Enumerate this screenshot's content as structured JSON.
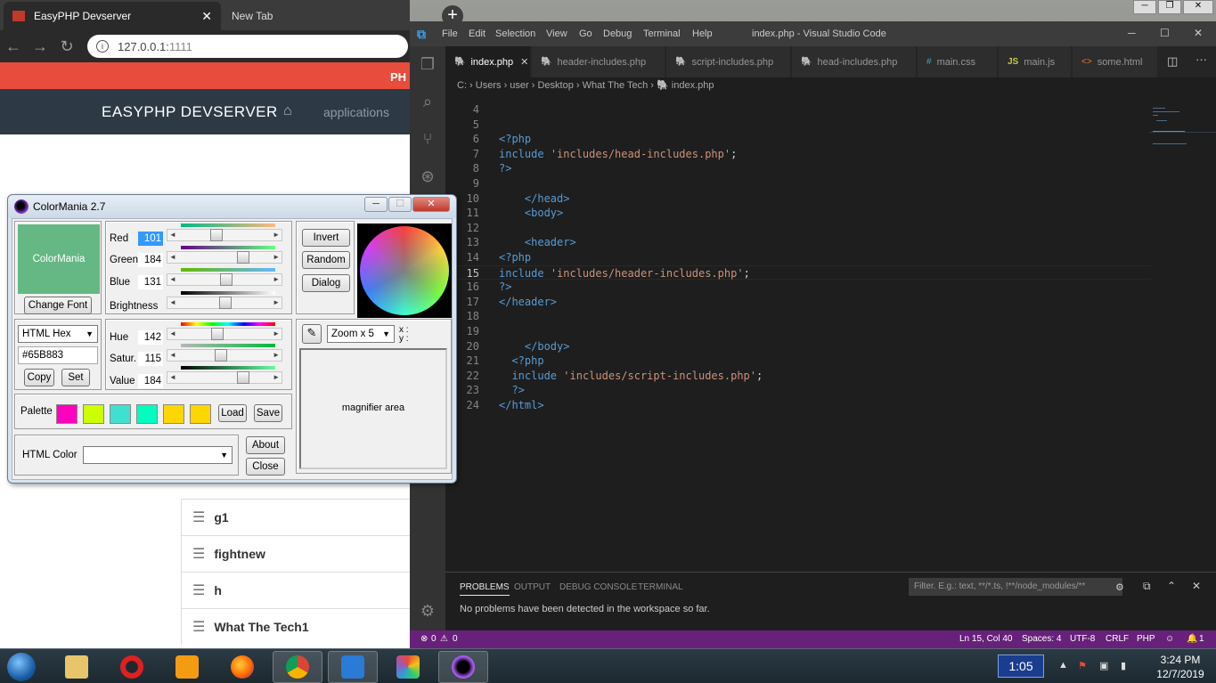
{
  "chrome": {
    "tab_active": "EasyPHP Devserver",
    "tab_active_close": "✕",
    "tab_new": "New Tab",
    "new_tab_plus": "+",
    "url_host": "127.0.0.1:",
    "url_port": "1111",
    "site": {
      "red_bar_text": "PH",
      "brand": "EASYPHP DEVSERVER",
      "nav_applications": "applications",
      "list_items": [
        "g1",
        "fightnew",
        "h",
        "What The Tech1"
      ]
    }
  },
  "vscode": {
    "menu": [
      "File",
      "Edit",
      "Selection",
      "View",
      "Go",
      "Debug",
      "Terminal",
      "Help"
    ],
    "title": "index.php - Visual Studio Code",
    "tabs": [
      {
        "label": "index.php",
        "type": "php",
        "active": true
      },
      {
        "label": "header-includes.php",
        "type": "php",
        "active": false
      },
      {
        "label": "script-includes.php",
        "type": "php",
        "active": false
      },
      {
        "label": "head-includes.php",
        "type": "php",
        "active": false
      },
      {
        "label": "main.css",
        "type": "css",
        "active": false
      },
      {
        "label": "main.js",
        "type": "js",
        "active": false
      },
      {
        "label": "some.html",
        "type": "html",
        "active": false
      }
    ],
    "breadcrumb": [
      "C:",
      "Users",
      "user",
      "Desktop",
      "What The Tech",
      "index.php"
    ],
    "code_lines": [
      {
        "n": "4",
        "code": ""
      },
      {
        "n": "5",
        "code": ""
      },
      {
        "n": "6",
        "code": "<?php"
      },
      {
        "n": "7",
        "code": "include 'includes/head-includes.php';"
      },
      {
        "n": "8",
        "code": "?>"
      },
      {
        "n": "9",
        "code": ""
      },
      {
        "n": "10",
        "code": "    </head>"
      },
      {
        "n": "11",
        "code": "    <body>"
      },
      {
        "n": "12",
        "code": ""
      },
      {
        "n": "13",
        "code": "    <header>"
      },
      {
        "n": "14",
        "code": "<?php"
      },
      {
        "n": "15",
        "code": "include 'includes/header-includes.php';"
      },
      {
        "n": "16",
        "code": "?>"
      },
      {
        "n": "17",
        "code": "</header>"
      },
      {
        "n": "18",
        "code": ""
      },
      {
        "n": "19",
        "code": ""
      },
      {
        "n": "20",
        "code": "    </body>"
      },
      {
        "n": "21",
        "code": "  <?php"
      },
      {
        "n": "22",
        "code": "  include 'includes/script-includes.php';"
      },
      {
        "n": "23",
        "code": "  ?>"
      },
      {
        "n": "24",
        "code": "</html>"
      }
    ],
    "current_line": "15",
    "panel": {
      "tabs": [
        "PROBLEMS",
        "OUTPUT",
        "DEBUG CONSOLE",
        "TERMINAL"
      ],
      "active_tab": "PROBLEMS",
      "filter_placeholder": "Filter. E.g.: text, **/*.ts, !**/node_modules/**",
      "message": "No problems have been detected in the workspace so far."
    },
    "status": {
      "errors": "0",
      "warnings": "0",
      "position": "Ln 15, Col 40",
      "spaces": "Spaces: 4",
      "encoding": "UTF-8",
      "eol": "CRLF",
      "language": "PHP",
      "notifications": "1"
    }
  },
  "colormania": {
    "title": "ColorMania 2.7",
    "preview_text": "ColorMania",
    "preview_color": "#65B883",
    "change_font": "Change Font",
    "rgb": [
      {
        "label": "Red",
        "value": "101",
        "fraction": 0.396
      },
      {
        "label": "Green",
        "value": "184",
        "fraction": 0.722
      },
      {
        "label": "Blue",
        "value": "131",
        "fraction": 0.514
      }
    ],
    "brightness_label": "Brightness",
    "brightness_fraction": 0.5,
    "format": "HTML Hex",
    "hex_value": "#65B883",
    "copy": "Copy",
    "set": "Set",
    "hsv": [
      {
        "label": "Hue",
        "value": "142",
        "fraction": 0.4
      },
      {
        "label": "Satur.",
        "value": "115",
        "fraction": 0.45
      },
      {
        "label": "Value",
        "value": "184",
        "fraction": 0.722
      }
    ],
    "invert": "Invert",
    "random": "Random",
    "dialog": "Dialog",
    "zoom": "Zoom x 5",
    "xy_label_x": "x :",
    "xy_label_y": "y :",
    "magnifier": "magnifier area",
    "palette_label": "Palette",
    "palette_colors": [
      "#ff00bf",
      "#ccff00",
      "#40e0d0",
      "#00ffbf",
      "#ffd700",
      "#ffd700"
    ],
    "load": "Load",
    "save": "Save",
    "html_color_label": "HTML Color",
    "about": "About",
    "close": "Close"
  },
  "taskbar": {
    "time_box": "1:05",
    "clock_time": "3:24 PM",
    "clock_date": "12/7/2019"
  }
}
